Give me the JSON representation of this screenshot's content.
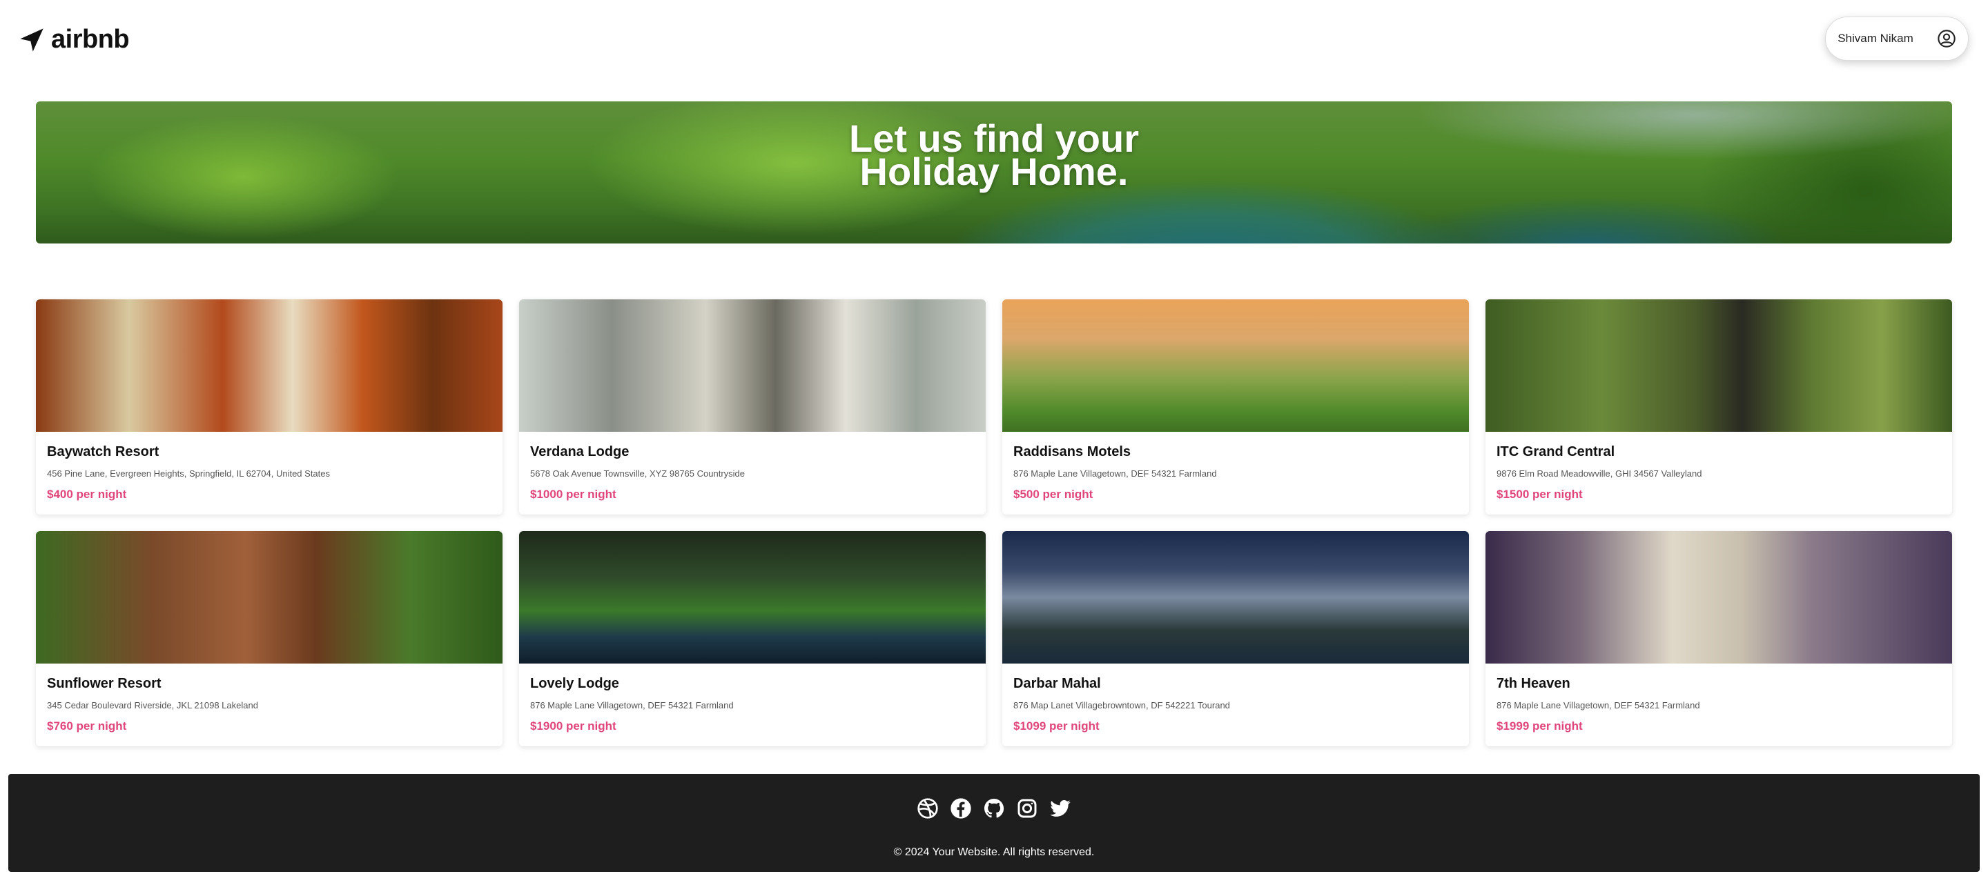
{
  "header": {
    "brand": "airbnb",
    "user_name": "Shivam Nikam"
  },
  "hero": {
    "line1": "Let us find your",
    "line2": "Holiday Home."
  },
  "listings": [
    {
      "name": "Baywatch Resort",
      "address": "456 Pine Lane, Evergreen Heights, Springfield, IL 62704, United States",
      "price": "$400 per night"
    },
    {
      "name": "Verdana Lodge",
      "address": "5678 Oak Avenue Townsville, XYZ 98765 Countryside",
      "price": "$1000 per night"
    },
    {
      "name": "Raddisans Motels",
      "address": "876 Maple Lane Villagetown, DEF 54321 Farmland",
      "price": "$500 per night"
    },
    {
      "name": "ITC Grand Central",
      "address": "9876 Elm Road Meadowville, GHI 34567 Valleyland",
      "price": "$1500 per night"
    },
    {
      "name": "Sunflower Resort",
      "address": "345 Cedar Boulevard Riverside, JKL 21098 Lakeland",
      "price": "$760 per night"
    },
    {
      "name": "Lovely Lodge",
      "address": "876 Maple Lane Villagetown, DEF 54321 Farmland",
      "price": "$1900 per night"
    },
    {
      "name": "Darbar Mahal",
      "address": "876 Map Lanet Villagebrowntown, DF 542221 Tourand",
      "price": "$1099 per night"
    },
    {
      "name": "7th Heaven",
      "address": "876 Maple Lane Villagetown, DEF 54321 Farmland",
      "price": "$1999 per night"
    }
  ],
  "footer": {
    "social_icons": [
      "dribbble-icon",
      "facebook-icon",
      "github-icon",
      "instagram-icon",
      "twitter-icon"
    ],
    "copyright": "© 2024 Your Website. All rights reserved."
  },
  "colors": {
    "price": "#e0457b",
    "footer_bg": "#1e1e1e"
  }
}
